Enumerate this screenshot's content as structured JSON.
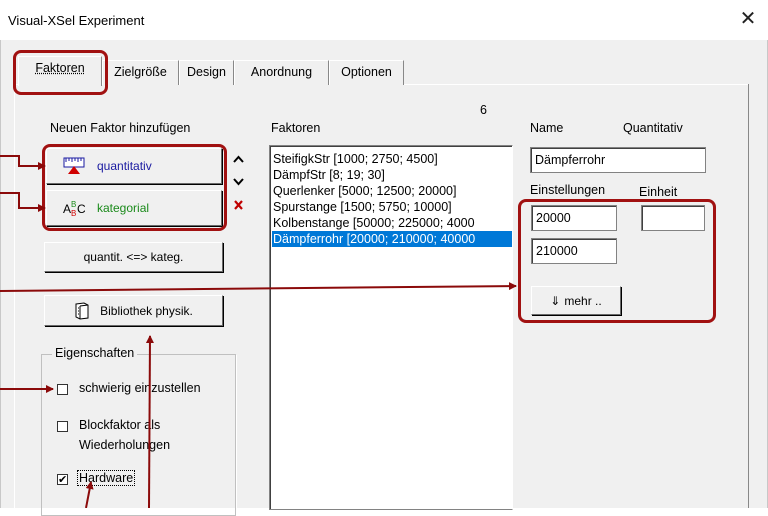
{
  "window": {
    "title": "Visual-XSel  Experiment",
    "close_glyph": "✕"
  },
  "tabs": [
    {
      "label": "Faktoren",
      "active": true
    },
    {
      "label": "Zielgröße",
      "active": false
    },
    {
      "label": "Design",
      "active": false
    },
    {
      "label": "Anordnung",
      "active": false
    },
    {
      "label": "Optionen",
      "active": false
    }
  ],
  "add_factor": {
    "heading": "Neuen Faktor hinzufügen",
    "quantitative_label": "quantitativ",
    "categorical_label": "kategorial",
    "convert_label": "quantit. <=> kateg.",
    "library_label": "Bibliothek physik."
  },
  "factor_list": {
    "count": "6",
    "heading": "Faktoren",
    "items": [
      "SteifigkStr [1000; 2750; 4500]",
      "DämpfStr [8; 19; 30]",
      "Querlenker [5000; 12500; 20000]",
      "Spurstange [1500; 5750; 10000]",
      "Kolbenstange [50000; 225000; 4000",
      "Dämpferrohr [20000; 210000; 40000"
    ],
    "selected_index": 5
  },
  "details": {
    "name_heading": "Name",
    "quantitative_heading": "Quantitativ",
    "name_value": "Dämpferrohr",
    "settings_heading": "Einstellungen",
    "unit_heading": "Einheit",
    "setting_1": "20000",
    "setting_2": "210000",
    "unit_value": "",
    "more_label": "mehr ..",
    "more_glyph": "⇓"
  },
  "properties": {
    "heading": "Eigenschaften",
    "difficult_label": "schwierig einzustellen",
    "difficult_checked": false,
    "block_label_1": "Blockfaktor als",
    "block_label_2": "Wiederholungen",
    "block_checked": false,
    "hardware_label": "Hardware",
    "hardware_checked": true,
    "check_mark": "✔"
  },
  "colors": {
    "accent_red": "#a11111",
    "selection_blue": "#0078d7",
    "quant_label": "#1a1aa0",
    "categ_label": "#1a8a1a"
  }
}
